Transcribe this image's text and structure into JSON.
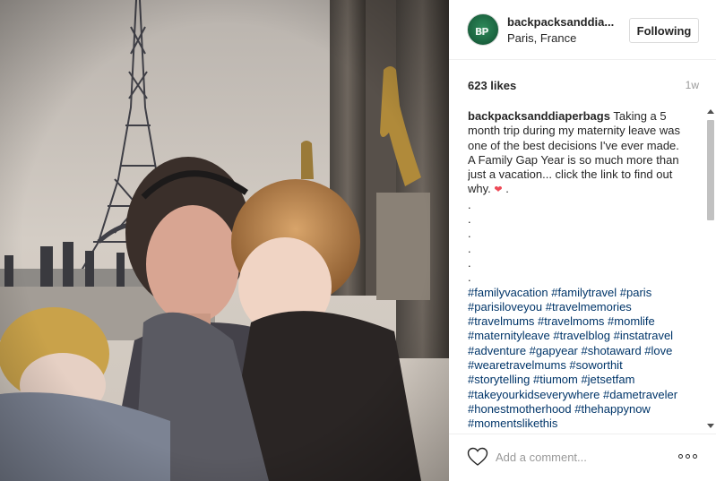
{
  "post": {
    "username": "backpacksanddia...",
    "location": "Paris, France",
    "follow_label": "Following",
    "likes": "623 likes",
    "time_ago": "1w",
    "caption": {
      "author": "backpacksanddiaperbags",
      "text": " Taking a 5 month trip during my maternity leave was one of the best decisions I've ever made. A Family Gap Year is so much more than just a vacation... click the link to find out why. ",
      "heart_glyph": "❤",
      "after_heart": " .",
      "dots": ".\n.\n.\n.\n.\n.",
      "hashtags": "#familyvacation #familytravel #paris #parisiloveyou #travelmemories #travelmums #travelmoms #momlife #maternityleave #travelblog #instatravel #adventure #gapyear #shotaward #love #wearetravelmums #soworthit #storytelling #tiumom #jetsetfam #takeyourkidseverywhere #dametraveler #honestmotherhood #thehappynow #momentslikethis"
    },
    "comment_placeholder": "Add a comment...",
    "avatar_mark": "BP"
  },
  "colors": {
    "link": "#003569",
    "muted": "#999999",
    "text": "#262626",
    "heart": "#ed4956",
    "border": "#dbdbdb"
  },
  "icons": {
    "like": "heart-outline-icon",
    "more": "ellipsis-icon",
    "avatar": "user-avatar"
  }
}
